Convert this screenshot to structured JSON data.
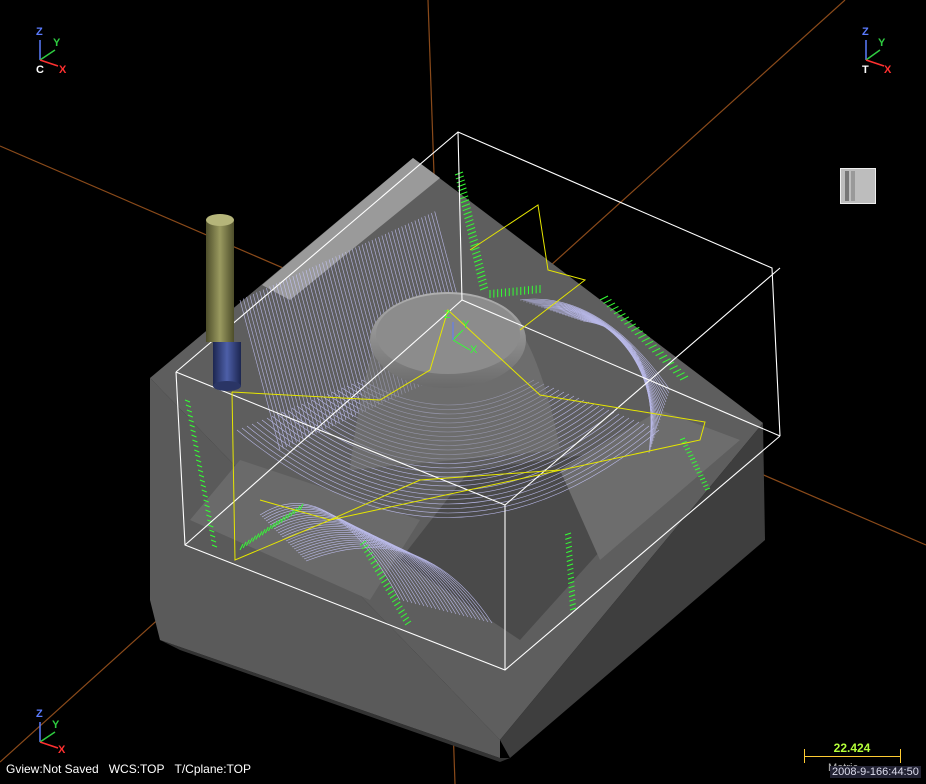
{
  "viewport": {
    "triad_top_left": {
      "z": "Z",
      "y": "Y",
      "x": "X",
      "origin": "C"
    },
    "triad_top_right": {
      "z": "Z",
      "y": "Y",
      "x": "X",
      "origin": "T"
    },
    "triad_bottom_left": {
      "z": "Z",
      "y": "Y",
      "x": "X"
    },
    "part_axis": {
      "z": "Z",
      "y": "Y",
      "x": "X"
    }
  },
  "status_bar": {
    "gview": "Gview:Not Saved",
    "wcs": "WCS:TOP",
    "tcplane": "T/Cplane:TOP"
  },
  "scale": {
    "value": "22.424",
    "matrix_label": "Metric",
    "timestamp": "2008-9-166:44:50"
  },
  "colors": {
    "background": "#000000",
    "toolpath": "#c8c8ff",
    "toolpath_green": "#33ff33",
    "boundary": "#ffffff",
    "axis_line": "#8a4a1a",
    "yellow_path": "#e6e600"
  },
  "icons": {
    "view_button": "view-shade-icon"
  }
}
